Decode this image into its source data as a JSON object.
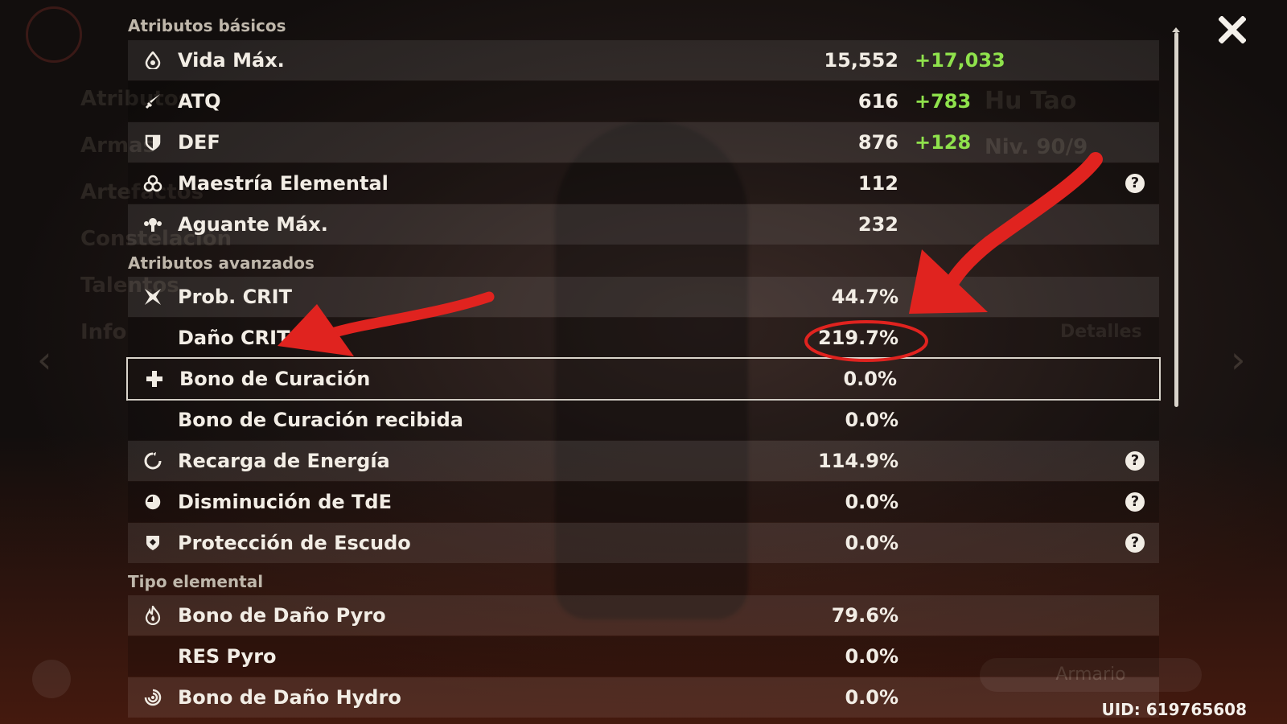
{
  "window": {
    "close_icon": "close-icon",
    "uid": "UID: 619765608"
  },
  "sections": {
    "basic": "Atributos básicos",
    "advanced": "Atributos avanzados",
    "elemental": "Tipo elemental"
  },
  "basic_stats": [
    {
      "icon": "droplet-icon",
      "label": "Vida Máx.",
      "value": "15,552",
      "bonus": "+17,033"
    },
    {
      "icon": "sword-icon",
      "label": "ATQ",
      "value": "616",
      "bonus": "+783"
    },
    {
      "icon": "shield-icon",
      "label": "DEF",
      "value": "876",
      "bonus": "+128"
    },
    {
      "icon": "elemental-mastery-icon",
      "label": "Maestría Elemental",
      "value": "112",
      "help": "?"
    },
    {
      "icon": "stamina-icon",
      "label": "Aguante Máx.",
      "value": "232"
    }
  ],
  "advanced_stats": [
    {
      "icon": "crit-icon",
      "label": "Prob. CRIT",
      "value": "44.7%"
    },
    {
      "icon": "",
      "label": "Daño CRIT",
      "value": "219.7%"
    },
    {
      "icon": "plus-icon",
      "label": "Bono de Curación",
      "value": "0.0%"
    },
    {
      "icon": "",
      "label": "Bono de Curación recibida",
      "value": "0.0%"
    },
    {
      "icon": "energy-recharge-icon",
      "label": "Recarga de Energía",
      "value": "114.9%",
      "help": "?"
    },
    {
      "icon": "cooldown-icon",
      "label": "Disminución de TdE",
      "value": "0.0%",
      "help": "?"
    },
    {
      "icon": "shield-strength-icon",
      "label": "Protección de Escudo",
      "value": "0.0%",
      "help": "?"
    }
  ],
  "elemental_stats": [
    {
      "icon": "pyro-icon",
      "label": "Bono de Daño Pyro",
      "value": "79.6%"
    },
    {
      "icon": "",
      "label": "RES Pyro",
      "value": "0.0%"
    },
    {
      "icon": "hydro-icon",
      "label": "Bono de Daño Hydro",
      "value": "0.0%"
    }
  ],
  "background": {
    "character_name": "Hu Tao",
    "level": "Niv. 90/9",
    "nav": [
      "Atributos",
      "Armas",
      "Artefactos",
      "Constelación",
      "Talentos",
      "Info"
    ],
    "details": "Detalles",
    "button": "Armario"
  },
  "colors": {
    "bonus": "#8fe24c",
    "annotation": "#e0231f"
  }
}
